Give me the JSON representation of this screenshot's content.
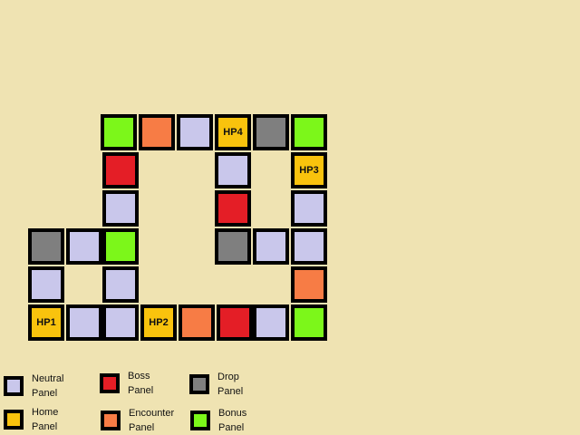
{
  "colors": {
    "background": "#efe3b2",
    "neutral": "#c9c7eb",
    "boss": "#e41e26",
    "drop": "#7f7f7f",
    "home": "#f9c30d",
    "encounter": "#f77c45",
    "bonus": "#7cf71a",
    "border": "#000000"
  },
  "tiles": [
    {
      "type": "bonus",
      "label": ""
    },
    {
      "type": "encounter",
      "label": ""
    },
    {
      "type": "neutral",
      "label": ""
    },
    {
      "type": "home",
      "label": "HP4"
    },
    {
      "type": "drop",
      "label": ""
    },
    {
      "type": "bonus",
      "label": ""
    },
    {
      "type": "boss",
      "label": ""
    },
    {
      "type": "neutral",
      "label": ""
    },
    {
      "type": "home",
      "label": "HP3"
    },
    {
      "type": "neutral",
      "label": ""
    },
    {
      "type": "boss",
      "label": ""
    },
    {
      "type": "neutral",
      "label": ""
    },
    {
      "type": "drop",
      "label": ""
    },
    {
      "type": "neutral",
      "label": ""
    },
    {
      "type": "bonus",
      "label": ""
    },
    {
      "type": "drop",
      "label": ""
    },
    {
      "type": "neutral",
      "label": ""
    },
    {
      "type": "neutral",
      "label": ""
    },
    {
      "type": "neutral",
      "label": ""
    },
    {
      "type": "neutral",
      "label": ""
    },
    {
      "type": "encounter",
      "label": ""
    },
    {
      "type": "home",
      "label": "HP1"
    },
    {
      "type": "neutral",
      "label": ""
    },
    {
      "type": "neutral",
      "label": ""
    },
    {
      "type": "home",
      "label": "HP2"
    },
    {
      "type": "encounter",
      "label": ""
    },
    {
      "type": "boss",
      "label": ""
    },
    {
      "type": "neutral",
      "label": ""
    },
    {
      "type": "bonus",
      "label": ""
    }
  ],
  "legend": [
    {
      "type": "neutral",
      "label": "Neutral\nPanel"
    },
    {
      "type": "boss",
      "label": "Boss\nPanel"
    },
    {
      "type": "drop",
      "label": "Drop\nPanel"
    },
    {
      "type": "home",
      "label": "Home\nPanel"
    },
    {
      "type": "encounter",
      "label": "Encounter\nPanel"
    },
    {
      "type": "bonus",
      "label": "Bonus\nPanel"
    }
  ]
}
